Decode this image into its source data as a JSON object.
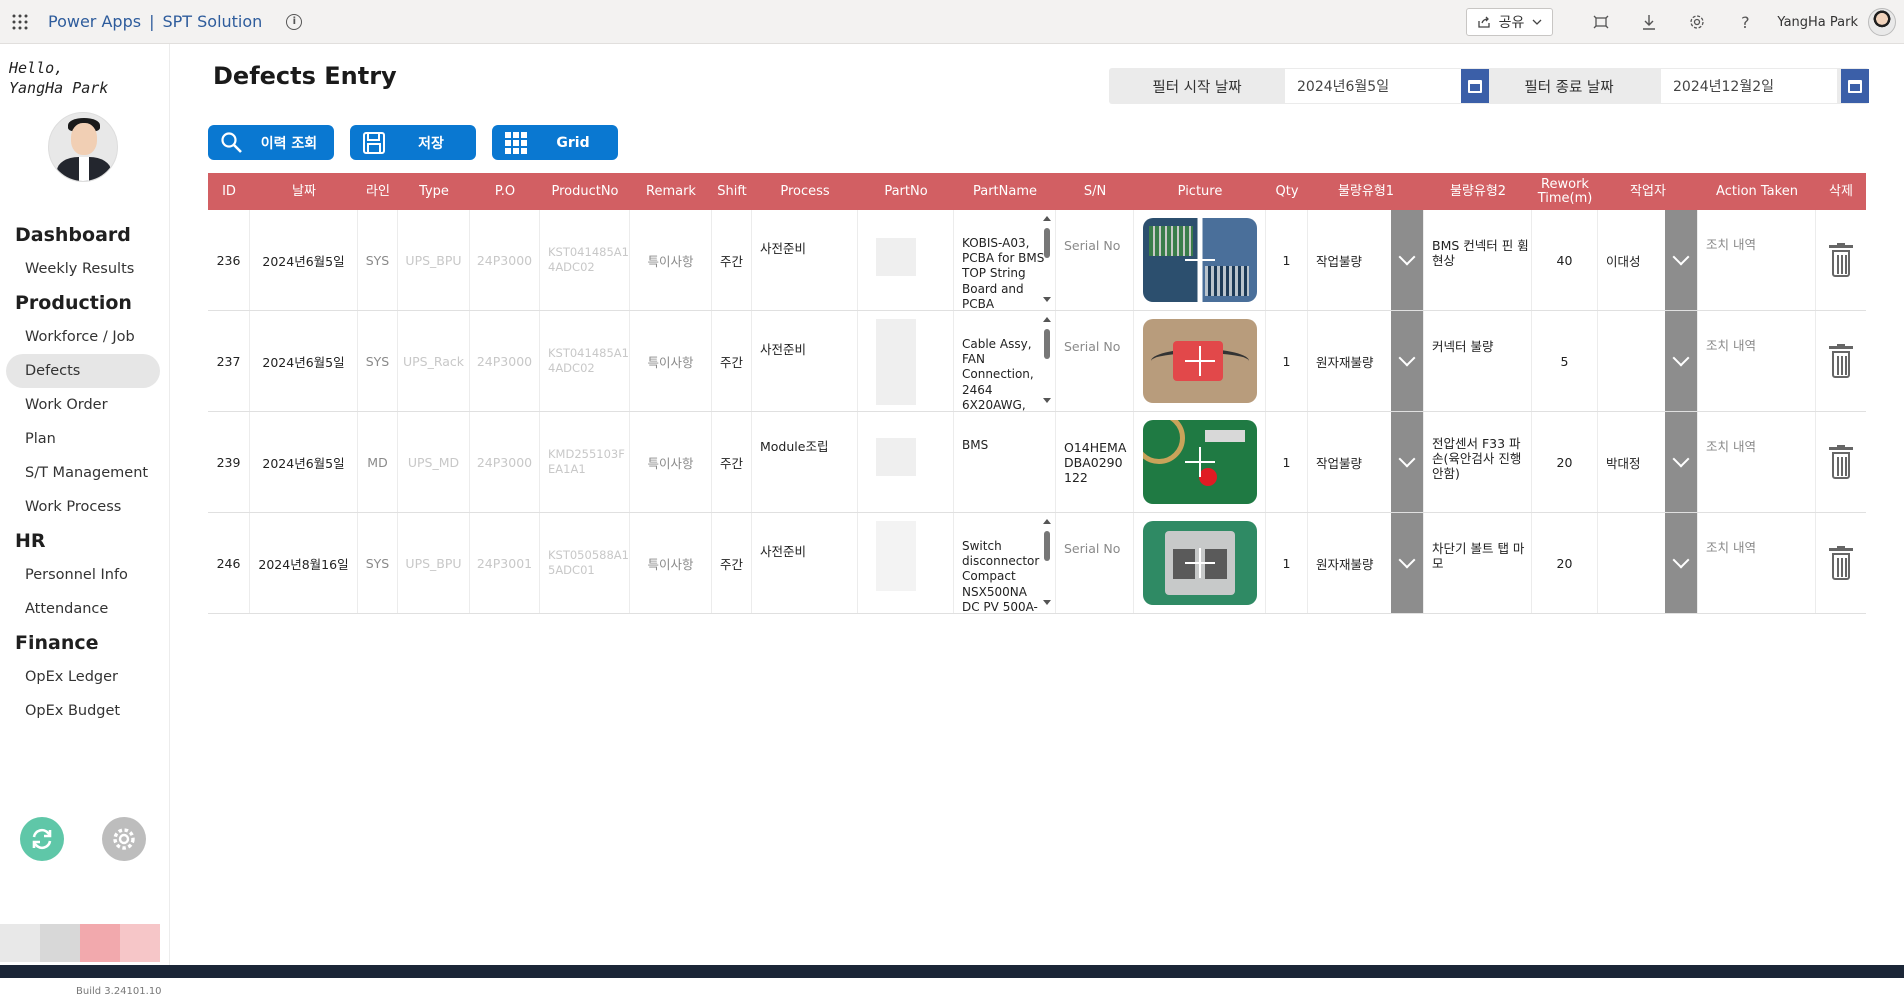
{
  "topbar": {
    "app_name": "Power Apps",
    "separator": "|",
    "solution": "SPT Solution",
    "share_label": "공유",
    "username": "YangHa Park"
  },
  "sidebar": {
    "hello_line1": "Hello,",
    "hello_line2": "YangHa Park",
    "sections": [
      {
        "title": "Dashboard",
        "items": [
          "Weekly Results"
        ]
      },
      {
        "title": "Production",
        "items": [
          "Workforce / Job",
          "Defects",
          "Work Order",
          "Plan",
          "S/T Management",
          "Work Process"
        ]
      },
      {
        "title": "HR",
        "items": [
          "Personnel Info",
          "Attendance"
        ]
      },
      {
        "title": "Finance",
        "items": [
          "OpEx Ledger",
          "OpEx Budget"
        ]
      }
    ],
    "active_item": "Defects",
    "version": "Build 3.24101.10"
  },
  "page": {
    "title": "Defects Entry",
    "filter_start_label": "필터 시작 날짜",
    "filter_start_value": "2024년6월5일",
    "filter_end_label": "필터 종료 날짜",
    "filter_end_value": "2024년12월2일"
  },
  "buttons": {
    "history": "이력 조회",
    "save": "저장",
    "grid": "Grid"
  },
  "table": {
    "headers": [
      "ID",
      "날짜",
      "라인",
      "Type",
      "P.O",
      "ProductNo",
      "Remark",
      "Shift",
      "Process",
      "PartNo",
      "PartName",
      "S/N",
      "Picture",
      "Qty",
      "불량유형1",
      "불량유형2",
      "Rework Time(m)",
      "작업자",
      "Action Taken",
      "삭제"
    ],
    "rows": [
      {
        "id": "236",
        "date": "2024년6월5일",
        "line": "SYS",
        "type": "UPS_BPU",
        "po": "24P3000",
        "product_no": "KST041485A14ADC02",
        "remark": "특이사항",
        "shift": "주간",
        "process": "사전준비",
        "part_name": "KOBIS-A03, PCBA for BMS TOP String Board and PCBA",
        "sn": "Serial No",
        "qty": "1",
        "defect1": "작업불량",
        "defect2": "BMS 컨넥터 핀 휨 현상",
        "rework": "40",
        "worker": "이대성",
        "action": "조치 내역"
      },
      {
        "id": "237",
        "date": "2024년6월5일",
        "line": "SYS",
        "type": "UPS_Rack",
        "po": "24P3000",
        "product_no": "KST041485A14ADC02",
        "remark": "특이사항",
        "shift": "주간",
        "process": "사전준비",
        "part_name": "Cable Assy, FAN Connection, 2464 6X20AWG,",
        "sn": "Serial No",
        "qty": "1",
        "defect1": "원자재불량",
        "defect2": "커넥터 불량",
        "rework": "5",
        "worker": "",
        "action": "조치 내역"
      },
      {
        "id": "239",
        "date": "2024년6월5일",
        "line": "MD",
        "type": "UPS_MD",
        "po": "24P3000",
        "product_no": "KMD255103FEA1A1",
        "remark": "특이사항",
        "shift": "주간",
        "process": "Module조립",
        "part_name": "BMS",
        "sn": "O14HEMADBA0290122",
        "qty": "1",
        "defect1": "작업불량",
        "defect2": "전압센서 F33 파손(육안검사 진행 안함)",
        "rework": "20",
        "worker": "박대정",
        "action": "조치 내역"
      },
      {
        "id": "246",
        "date": "2024년8월16일",
        "line": "SYS",
        "type": "UPS_BPU",
        "po": "24P3001",
        "product_no": "KST050588A15ADC01",
        "remark": "특이사항",
        "shift": "주간",
        "process": "사전준비",
        "part_name": "Switch disconnector Compact NSX500NA DC PV 500A-",
        "sn": "Serial No",
        "qty": "1",
        "defect1": "원자재불량",
        "defect2": "차단기 볼트 탭 마모",
        "rework": "20",
        "worker": "",
        "action": "조치 내역"
      }
    ]
  }
}
